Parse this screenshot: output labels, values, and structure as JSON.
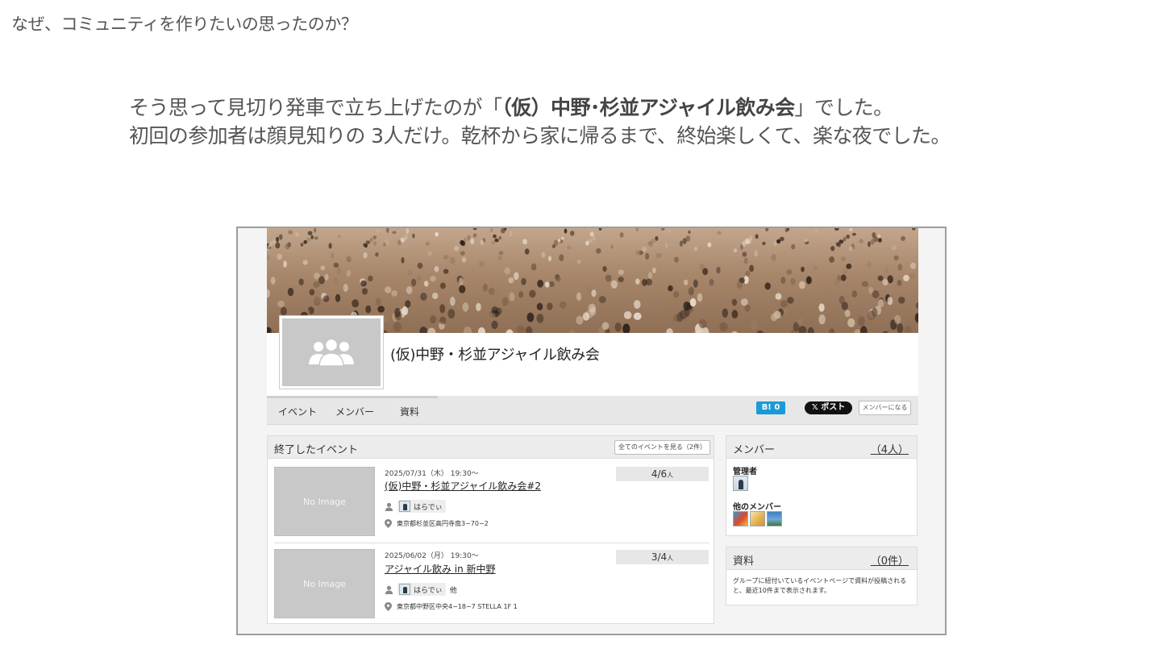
{
  "question": "なぜ、コミュニティを作りたいの思ったのか？",
  "lead": {
    "line1_pre": "そう思って見切り発車で立ち上げたのが「",
    "line1_bold": "（仮）中野･杉並アジャイル飲み会",
    "line1_post": "」でした。",
    "line2": "初回の参加者は顔見知りの 3人だけ。乾杯から家に帰るまで、終始楽しくて、楽な夜でした。"
  },
  "group": {
    "title": "(仮)中野・杉並アジャイル飲み会"
  },
  "tabs": [
    "イベント",
    "メンバー",
    "資料"
  ],
  "social": {
    "hatena_label": "B! 0",
    "xpost_label": "𝕏 ポスト",
    "join_label": "メンバーになる"
  },
  "events_panel": {
    "heading": "終了したイベント",
    "all_button": "全てのイベントを見る（2件）",
    "no_image": "No Image",
    "items": [
      {
        "date": "2025/07/31（木） 19:30〜",
        "title": "(仮)中野・杉並アジャイル飲み会#2",
        "host": "はらでぃ",
        "host_suffix": "",
        "place": "東京都杉並区高円寺南3−70−2",
        "count": "4/6",
        "unit": "人"
      },
      {
        "date": "2025/06/02（月） 19:30〜",
        "title": "アジャイル飲み in 新中野",
        "host": "はらでぃ",
        "host_suffix": "他",
        "place": "東京都中野区中央4−18−7 STELLA 1F 1",
        "count": "3/4",
        "unit": "人"
      }
    ]
  },
  "members_panel": {
    "heading": "メンバー",
    "count": "（4人）",
    "admin_label": "管理者",
    "others_label": "他のメンバー"
  },
  "docs_panel": {
    "heading": "資料",
    "count": "（0件）",
    "description": "グループに紐付いているイベントページで資料が投稿されると、最近10件まで表示されます。"
  },
  "colors": {
    "hatena": "#1b9ad6",
    "xpost": "#111111",
    "panel_head": "#ececec"
  },
  "icons": [
    "group-placeholder-icon",
    "person-icon",
    "map-pin-icon"
  ]
}
